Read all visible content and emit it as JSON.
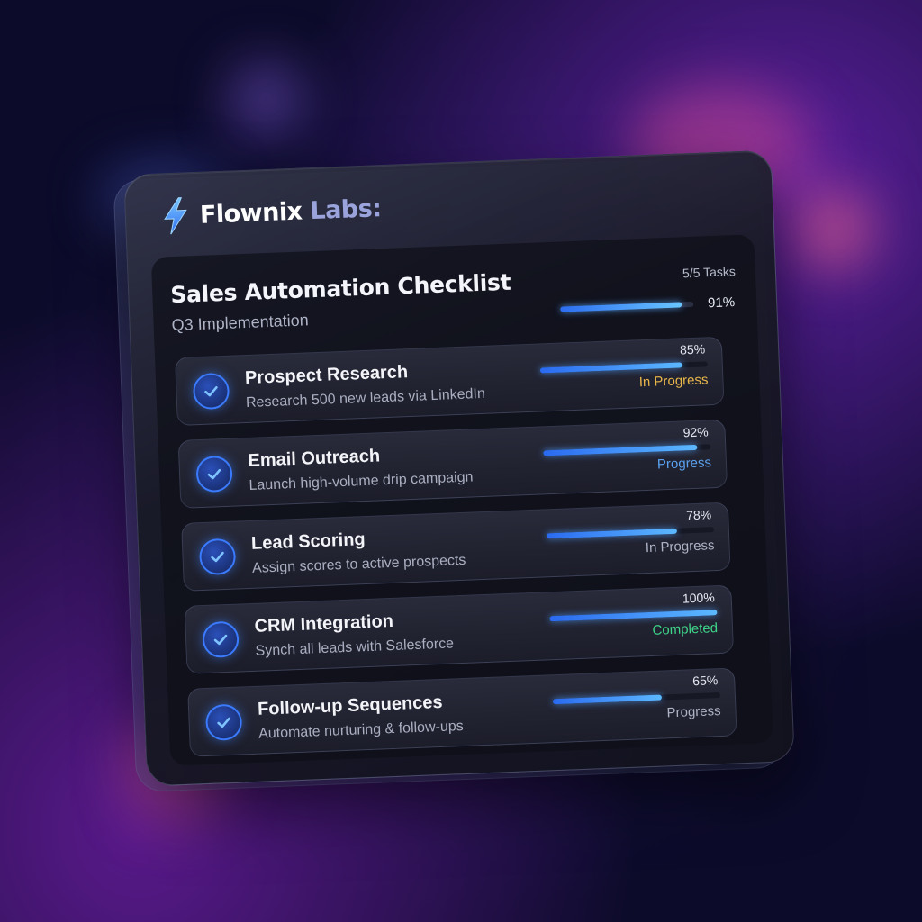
{
  "brand": {
    "name": "Flownix",
    "suffix": "Labs:"
  },
  "checklist": {
    "title": "Sales Automation Checklist",
    "subtitle": "Q3 Implementation",
    "task_count": "5/5 Tasks",
    "overall_progress": 91,
    "overall_progress_label": "91%"
  },
  "tasks": [
    {
      "title": "Prospect Research",
      "description": "Research 500 new leads via LinkedIn",
      "progress": 85,
      "progress_label": "85%",
      "status": "In Progress",
      "status_color": "#e8b64a"
    },
    {
      "title": "Email Outreach",
      "description": "Launch high-volume drip campaign",
      "progress": 92,
      "progress_label": "92%",
      "status": "Progress",
      "status_color": "#5aa2f0"
    },
    {
      "title": "Lead Scoring",
      "description": "Assign scores to active prospects",
      "progress": 78,
      "progress_label": "78%",
      "status": "In Progress",
      "status_color": "#aeb3c6"
    },
    {
      "title": "CRM Integration",
      "description": "Synch all leads with Salesforce",
      "progress": 100,
      "progress_label": "100%",
      "status": "Completed",
      "status_color": "#3ed68a"
    },
    {
      "title": "Follow-up Sequences",
      "description": "Automate nurturing & follow-ups",
      "progress": 65,
      "progress_label": "65%",
      "status": "Progress",
      "status_color": "#aeb3c6"
    }
  ],
  "icons": {
    "brand": "lightning-bolt-icon",
    "task_check": "checkmark-icon"
  },
  "colors": {
    "accent": "#3b7bff",
    "background": "#0c0b2a"
  }
}
